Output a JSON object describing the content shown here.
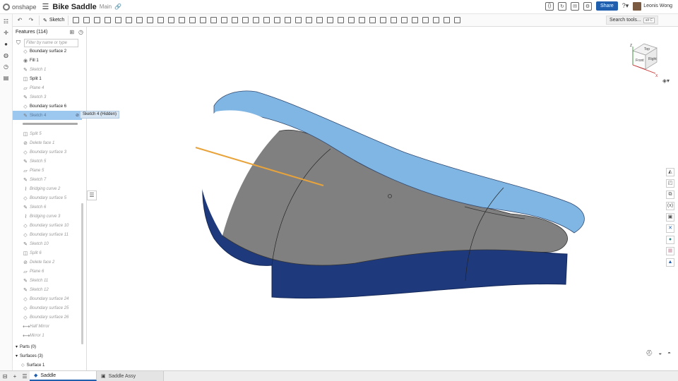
{
  "app": {
    "brand": "onshape",
    "document_title": "Bike Saddle",
    "branch": "Main",
    "share_label": "Share",
    "user_name": "Leonis Wong"
  },
  "toolbar": {
    "sketch_label": "Sketch",
    "search_label": "Search tools...",
    "search_shortcut": "alt C"
  },
  "feature_panel": {
    "header": "Features (114)",
    "filter_placeholder": "Filter by name or type",
    "items": [
      {
        "label": "Boundary surface 2",
        "state": "active",
        "icon": "boundary-surface-icon"
      },
      {
        "label": "Fill 1",
        "state": "active",
        "icon": "fill-icon"
      },
      {
        "label": "Sketch 1",
        "state": "suppressed",
        "icon": "sketch-icon"
      },
      {
        "label": "Split 1",
        "state": "active",
        "icon": "split-icon"
      },
      {
        "label": "Plane 4",
        "state": "suppressed",
        "icon": "plane-icon"
      },
      {
        "label": "Sketch 3",
        "state": "suppressed",
        "icon": "sketch-icon"
      },
      {
        "label": "Boundary surface 6",
        "state": "active",
        "icon": "boundary-surface-icon"
      },
      {
        "label": "Sketch 4",
        "state": "selected",
        "icon": "sketch-icon"
      }
    ],
    "rolled_items": [
      {
        "label": "Split 5",
        "icon": "split-icon"
      },
      {
        "label": "Delete face 1",
        "icon": "delete-face-icon"
      },
      {
        "label": "Boundary surface 3",
        "icon": "boundary-surface-icon"
      },
      {
        "label": "Sketch 5",
        "icon": "sketch-icon"
      },
      {
        "label": "Plane 5",
        "icon": "plane-icon"
      },
      {
        "label": "Sketch 7",
        "icon": "sketch-icon"
      },
      {
        "label": "Bridging curve 2",
        "icon": "bridging-curve-icon"
      },
      {
        "label": "Boundary surface 5",
        "icon": "boundary-surface-icon"
      },
      {
        "label": "Sketch 6",
        "icon": "sketch-icon"
      },
      {
        "label": "Bridging curve 3",
        "icon": "bridging-curve-icon"
      },
      {
        "label": "Boundary surface 10",
        "icon": "boundary-surface-icon"
      },
      {
        "label": "Boundary surface 11",
        "icon": "boundary-surface-icon"
      },
      {
        "label": "Sketch 10",
        "icon": "sketch-icon"
      },
      {
        "label": "Split 6",
        "icon": "split-icon"
      },
      {
        "label": "Delete face 2",
        "icon": "delete-face-icon"
      },
      {
        "label": "Plane 6",
        "icon": "plane-icon"
      },
      {
        "label": "Sketch 11",
        "icon": "sketch-icon"
      },
      {
        "label": "Sketch 12",
        "icon": "sketch-icon"
      },
      {
        "label": "Boundary surface 24",
        "icon": "boundary-surface-icon"
      },
      {
        "label": "Boundary surface 25",
        "icon": "boundary-surface-icon"
      },
      {
        "label": "Boundary surface 26",
        "icon": "boundary-surface-icon"
      },
      {
        "label": "Half Mirror",
        "icon": "mirror-icon"
      },
      {
        "label": "Mirror 1",
        "icon": "mirror-icon"
      }
    ],
    "tooltip": "Sketch 4 (Hidden)",
    "parts_label": "Parts (0)",
    "surfaces_label": "Surfaces (3)",
    "surface_item": "Surface 1"
  },
  "tabs": [
    {
      "label": "Saddle",
      "active": true
    },
    {
      "label": "Saddle Assy",
      "active": false
    }
  ],
  "viewcube": {
    "top": "Top",
    "front": "Front",
    "right": "Right",
    "axis_z": "Z",
    "axis_x": "X"
  },
  "colors": {
    "accent": "#1f5fae",
    "surface_light_blue": "#7fb6e3",
    "surface_dark_blue": "#1e3a7c",
    "saddle_gray": "#7d7d7d",
    "sketch_line": "#e8a33a",
    "selection": "#9cc7ef"
  }
}
